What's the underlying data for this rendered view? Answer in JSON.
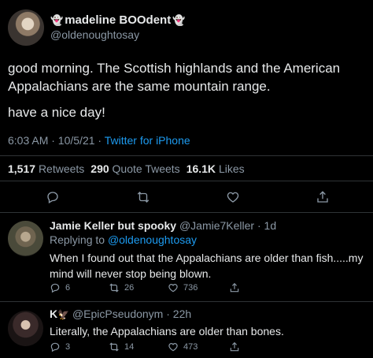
{
  "main": {
    "author": {
      "display_name": "madeline BOOdent",
      "ghost_glyph": "👻",
      "handle": "@oldenoughtosay"
    },
    "text_1": "good morning. The Scottish highlands and the American Appalachians are the same mountain range.",
    "text_2": "have a nice day!",
    "time": "6:03 AM · 10/5/21 · ",
    "source": "Twitter for iPhone",
    "stats": {
      "retweets_count": "1,517",
      "retweets_label": "Retweets",
      "quotes_count": "290",
      "quotes_label": "Quote Tweets",
      "likes_count": "16.1K",
      "likes_label": "Likes"
    },
    "actions": [
      "reply-icon",
      "retweet-icon",
      "like-icon",
      "share-icon"
    ]
  },
  "replies": [
    {
      "name": "Jamie Keller but spooky",
      "handle": "@Jamie7Keller · 1d",
      "replying_prefix": "Replying to ",
      "replying_to": "@oldenoughtosay",
      "text": "When I found out that the Appalachians are older than fish.....my mind will never stop being blown.",
      "reply_count": "6",
      "retweet_count": "26",
      "like_count": "736"
    },
    {
      "name": "K",
      "emoji": "🦅",
      "handle": "@EpicPseudonym · 22h",
      "text": "Literally, the Appalachians are older than bones.",
      "reply_count": "3",
      "retweet_count": "14",
      "like_count": "473"
    }
  ],
  "colors": {
    "background": "#000000",
    "text": "#e7e9ea",
    "muted": "#8b98a5",
    "link": "#1d9bf0",
    "divider": "#2f3336"
  }
}
